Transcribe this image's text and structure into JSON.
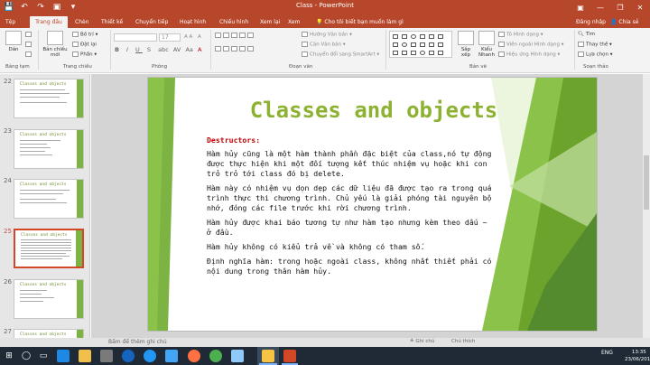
{
  "window": {
    "title": "Class - PowerPoint",
    "ribbon_options_label": "▣",
    "min_label": "—",
    "restore_label": "❐",
    "close_label": "✕"
  },
  "qat": {
    "save": "💾",
    "undo": "↶",
    "redo": "↷",
    "start": "▣",
    "more": "▾"
  },
  "tabs": [
    {
      "label": "Tệp"
    },
    {
      "label": "Trang đầu",
      "active": true
    },
    {
      "label": "Chèn"
    },
    {
      "label": "Thiết kế"
    },
    {
      "label": "Chuyển tiếp"
    },
    {
      "label": "Hoạt hình"
    },
    {
      "label": "Chiếu hình"
    },
    {
      "label": "Xem lại"
    },
    {
      "label": "Xem"
    }
  ],
  "tellme": "💡 Cho tôi biết bạn muốn làm gì",
  "signin": "Đăng nhập",
  "share": "👤 Chia sẻ",
  "ribbon": {
    "clipboard": {
      "paste": "Dán",
      "group": "Bảng tạm"
    },
    "slides": {
      "new_slide": "Bản chiếu mới",
      "layout": "Bố trí ▾",
      "reset": "Đặt lại",
      "section": "Phần ▾",
      "group": "Trang chiếu"
    },
    "font": {
      "size": "17",
      "bold": "B",
      "italic": "I",
      "underline": "U",
      "strike": "S",
      "shadow": "abc",
      "spacing": "AV",
      "case": "Aa",
      "color": "A",
      "group": "Phông"
    },
    "paragraph": {
      "text_direction": "Hướng Văn bản ▾",
      "align_text": "Căn Văn bản ▾",
      "smartart": "Chuyển đổi sang SmartArt ▾",
      "group": "Đoạn văn"
    },
    "drawing": {
      "arrange": "Sắp xếp",
      "quick_styles": "Kiểu Nhanh",
      "shape_fill": "Tô Hình dạng ▾",
      "shape_outline": "Viền ngoài Hình dạng ▾",
      "shape_effects": "Hiệu ứng Hình dạng ▾",
      "group": "Bản vẽ"
    },
    "editing": {
      "find": "Tìm",
      "replace": "Thay thế ▾",
      "select": "Lựa chọn ▾",
      "group": "Soạn thảo"
    }
  },
  "thumbnails": [
    {
      "num": "22",
      "title": "Classes and objects"
    },
    {
      "num": "23",
      "title": "Classes and objects"
    },
    {
      "num": "24",
      "title": "Classes and objects"
    },
    {
      "num": "25",
      "title": "Classes and objects",
      "selected": true
    },
    {
      "num": "26",
      "title": "Classes and objects"
    },
    {
      "num": "27",
      "title": "Classes and objects"
    }
  ],
  "slide": {
    "title": "Classes and objects",
    "heading": "Destructors:",
    "paragraphs": [
      "Hàm hủy cũng là một hàm thành phần đặc biệt của class,nó tự động được thực hiện khi một đối tượng kết thúc nhiệm vụ hoặc khi con trỏ trỏ tới class đó bị delete.",
      "Hàm này có nhiệm vụ dọn dẹp các dữ liệu đã được tạo ra trong quá trình thực thi chương trình. Chủ yếu là giải phóng tài nguyên bộ nhớ, đóng các file trước khi rời chương trình.",
      "Hàm hủy được khai báo tương tự như hàm tạo nhưng kèm theo dấu ~ ở đầu.",
      "Hàm hủy không có kiểu trả về và không có tham số.",
      "Định nghĩa hàm: trong hoặc ngoài class, không nhất thiết phải có nội dung trong thân hàm hủy."
    ]
  },
  "status": {
    "notes": "Bấm để thêm ghi chú",
    "notes_btn": "≙ Ghi chú",
    "comments_btn": "Chú thích"
  },
  "taskbar": {
    "start": "⊞",
    "search": "◯",
    "taskview": "▭",
    "tray_lang": "ENG",
    "time": "13:35",
    "date": "23/06/2016"
  },
  "colors": {
    "accent": "#b7472a",
    "title_green": "#8db232",
    "heading_red": "#c00000",
    "taskbar": "#1f2a36"
  }
}
